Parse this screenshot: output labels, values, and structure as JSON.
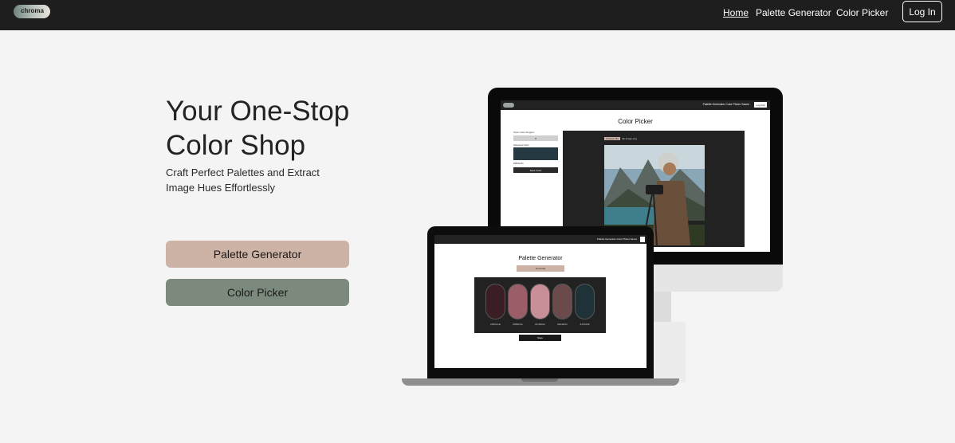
{
  "nav": {
    "logo_text": "chroma",
    "links": [
      "Home",
      "Palette Generator",
      "Color Picker"
    ],
    "login_label": "Log In"
  },
  "hero": {
    "title": "Your One-Stop Color Shop",
    "subtitle": "Craft Perfect Palettes and Extract Image Hues Effortlessly",
    "buttons": [
      "Palette Generator",
      "Color Picker"
    ]
  },
  "colors": {
    "nav_bg": "#1e1e1e",
    "page_bg": "#f4f4f4",
    "palette_button": "#cdb2a6",
    "picker_button": "#7c8a7d"
  },
  "desktop_mockup": {
    "nav_links": "Palette Generator   Color Picker   Saves",
    "nav_button": "Log Out",
    "title": "Color Picker",
    "dropper_label": "Open color dropper:",
    "dropper_icon": "eyedropper-icon",
    "selected_label": "Selected Color:",
    "selected_color": "#243942",
    "hex_value": "#3B4A4C",
    "save_label": "Save Color",
    "file_button": "Choose File",
    "file_status": "fuji-image.png"
  },
  "laptop_mockup": {
    "nav_links": "Palette Generator   Color Picker   Saves",
    "title": "Palette Generator",
    "regenerate_label": "Generate",
    "swatches": [
      {
        "color": "#3a1e23",
        "hex": "#3B1A1E"
      },
      {
        "color": "#9b5e69",
        "hex": "#9B5F6A"
      },
      {
        "color": "#c98f99",
        "hex": "#C48A93"
      },
      {
        "color": "#6b4a4b",
        "hex": "#6A4B4C"
      },
      {
        "color": "#1f3238",
        "hex": "#1F3338"
      }
    ],
    "save_label": "Save"
  }
}
